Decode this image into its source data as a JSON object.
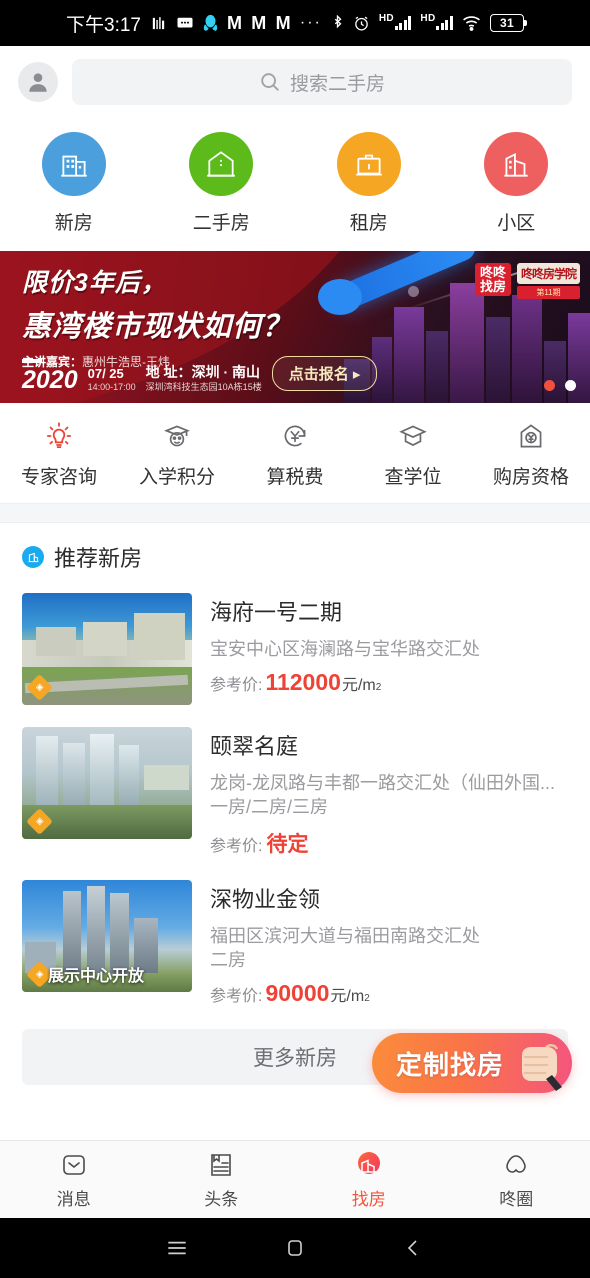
{
  "status_bar": {
    "time": "下午3:17",
    "icons": [
      "music-note-icon",
      "sms-icon",
      "qq-penguin-icon",
      "gmail-icon",
      "gmail-icon",
      "gmail-icon",
      "overflow-dots-icon",
      "bluetooth-icon",
      "alarm-icon",
      "hd-signal-icon",
      "hd-signal-icon",
      "wifi-icon"
    ],
    "overflow": "···",
    "hd_label": "HD",
    "battery": "31"
  },
  "search": {
    "placeholder": "搜索二手房",
    "avatar_icon": "user-avatar-icon",
    "search_icon": "search-icon"
  },
  "categories": [
    {
      "label": "新房",
      "icon": "apartment-building-icon",
      "color": "#4a9fdc"
    },
    {
      "label": "二手房",
      "icon": "house-icon",
      "color": "#5cba1a"
    },
    {
      "label": "租房",
      "icon": "briefcase-icon",
      "color": "#f5a623"
    },
    {
      "label": "小区",
      "icon": "community-building-icon",
      "color": "#ee5f5f"
    }
  ],
  "banner": {
    "line1": "限价3年后，",
    "line2": "惠湾楼市现状如何？",
    "speaker_label": "主讲嘉宾：",
    "speaker": "惠州牛浩思-王炜",
    "year": "2020",
    "date": "07/ 25",
    "time_range": "14:00-17:00",
    "address_label": "地 址：",
    "address": "深圳 · 南山",
    "venue": "深圳湾科技生态园10A栋15楼",
    "cta": "点击报名 ▸",
    "logo_main": "咚咚\n找房",
    "logo_main_l1": "咚咚",
    "logo_main_l2": "找房",
    "logo_sub_top": "咚咚房学院",
    "logo_sub_bottom": "第11期",
    "dots": [
      {
        "name": "banner-dot-1",
        "active": false,
        "color": "#f0503c"
      },
      {
        "name": "banner-dot-2",
        "active": true,
        "color": "#ffffff"
      }
    ]
  },
  "tools": [
    {
      "label": "专家咨询",
      "icon": "lightbulb-icon",
      "color": "#ef4236"
    },
    {
      "label": "入学积分",
      "icon": "graduation-face-icon",
      "color": "#6a6a6e"
    },
    {
      "label": "算税费",
      "icon": "yuan-refresh-icon",
      "color": "#6a6a6e"
    },
    {
      "label": "查学位",
      "icon": "graduation-cap-icon",
      "color": "#6a6a6e"
    },
    {
      "label": "购房资格",
      "icon": "house-yuan-icon",
      "color": "#6a6a6e"
    }
  ],
  "section": {
    "icon": "new-house-badge-icon",
    "title": "推荐新房"
  },
  "listings": [
    {
      "name": "海府一号二期",
      "address": "宝安中心区海澜路与宝华路交汇处",
      "rooms": "",
      "price_label": "参考价:",
      "price_value": "112000",
      "price_unit": "元/m",
      "price_sup": "2",
      "tbd": "",
      "thumb_caption": "",
      "thumb_badge": "◈"
    },
    {
      "name": "颐翠名庭",
      "address": "龙岗-龙凤路与丰都一路交汇处（仙田外国...",
      "rooms": "一房/二房/三房",
      "price_label": "参考价:",
      "price_value": "",
      "price_unit": "",
      "price_sup": "",
      "tbd": "待定",
      "thumb_caption": "",
      "thumb_badge": "◈"
    },
    {
      "name": "深物业金领",
      "address": "福田区滨河大道与福田南路交汇处",
      "rooms": "二房",
      "price_label": "参考价:",
      "price_value": "90000",
      "price_unit": "元/m",
      "price_sup": "2",
      "tbd": "",
      "thumb_caption": "展示中心开放",
      "thumb_badge": "◈"
    }
  ],
  "more": {
    "label": "更多新房"
  },
  "fab": {
    "label": "定制找房",
    "icon": "fist-hand-icon"
  },
  "tabbar": [
    {
      "label": "消息",
      "icon": "message-icon",
      "active": false
    },
    {
      "label": "头条",
      "icon": "news-icon",
      "active": false
    },
    {
      "label": "找房",
      "icon": "find-house-icon",
      "active": true
    },
    {
      "label": "咚圈",
      "icon": "circle-icon",
      "active": false
    }
  ],
  "android_nav": [
    {
      "name": "recents-button",
      "icon": "menu-icon"
    },
    {
      "name": "home-button",
      "icon": "square-icon"
    },
    {
      "name": "back-button",
      "icon": "chevron-left-icon"
    }
  ],
  "colors": {
    "accent_orange": "#f5533d",
    "price_red": "#ef4236",
    "link_blue": "#1aaaf0"
  }
}
